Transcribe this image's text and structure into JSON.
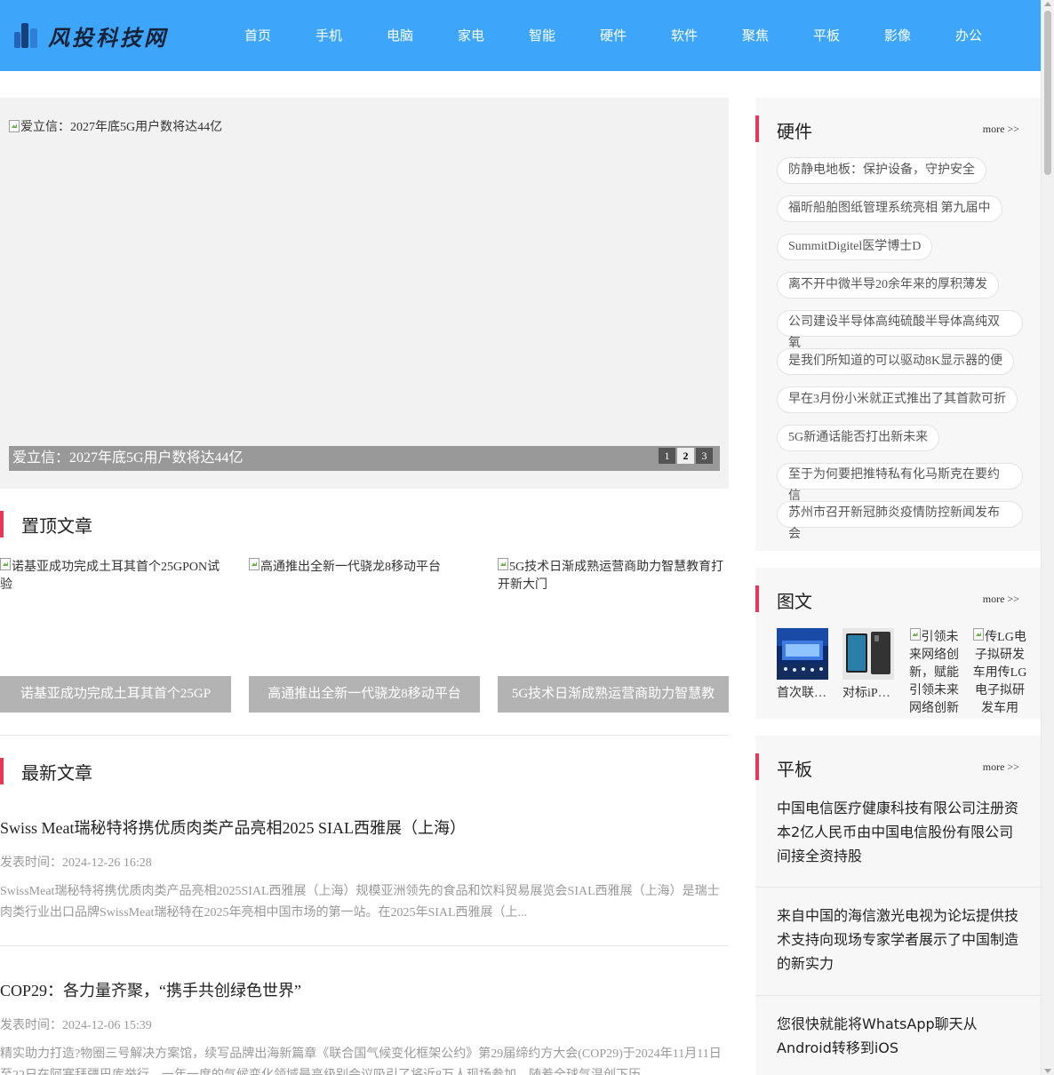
{
  "header": {
    "logo_text": "风投科技网",
    "nav": [
      "首页",
      "手机",
      "电脑",
      "家电",
      "智能",
      "硬件",
      "软件",
      "聚焦",
      "平板",
      "影像",
      "办公"
    ]
  },
  "slider": {
    "image_alt": "爱立信：2027年底5G用户数将达44亿",
    "caption": "爱立信：2027年底5G用户数将达44亿",
    "pages": [
      "1",
      "2",
      "3"
    ],
    "active_page": "2"
  },
  "top_section": {
    "title": "置顶文章",
    "cards": [
      {
        "alt": "诺基亚成功完成土耳其首个25GPON试验",
        "caption": "诺基亚成功完成土耳其首个25GP"
      },
      {
        "alt": "高通推出全新一代骁龙8移动平台",
        "caption": "高通推出全新一代骁龙8移动平台"
      },
      {
        "alt": "5G技术日渐成熟运营商助力智慧教育打开新大门",
        "caption": "5G技术日渐成熟运营商助力智慧教"
      }
    ]
  },
  "latest_section": {
    "title": "最新文章",
    "time_label": "发表时间：",
    "articles": [
      {
        "title": "Swiss Meat瑞秘特将携优质肉类产品亮相2025 SIAL西雅展（上海）",
        "time": "2024-12-26 16:28",
        "summary": "SwissMeat瑞秘特将携优质肉类产品亮相2025SIAL西雅展（上海）规模亚洲领先的食品和饮料贸易展览会SIAL西雅展（上海）是瑞士肉类行业出口品牌SwissMeat瑞秘特在2025年亮相中国市场的第一站。在2025年SIAL西雅展（上..."
      },
      {
        "title": "COP29：各力量齐聚，“携手共创绿色世界”",
        "time": "2024-12-06 15:39",
        "summary": "精实助力打造?物圈三号解决方案馆，续写品牌出海新篇章《联合国气候变化框架公约》第29届缔约方大会(COP29)于2024年11月11日至22日在阿塞拜疆巴库举行。一年一度的气候变化领域最高级别会议吸引了将近8万人现场参加。随着全球气温创下历"
      }
    ]
  },
  "sidebar": {
    "hardware": {
      "title": "硬件",
      "more": "more >>",
      "tags": [
        "防静电地板：保护设备，守护安全",
        "福昕船舶图纸管理系统亮相 第九届中",
        "SummitDigitel医学博士D",
        "离不开中微半导20余年来的厚积薄发",
        "公司建设半导体高纯硫酸半导体高纯双氧",
        "是我们所知道的可以驱动8K显示器的便",
        "早在3月份小米就正式推出了其首款可折",
        "5G新通话能否打出新未来",
        "至于为何要把推特私有化马斯克在要约信",
        "苏州市召开新冠肺炎疫情防控新闻发布会"
      ]
    },
    "pictures": {
      "title": "图文",
      "more": "more >>",
      "items": [
        {
          "caption": "首次联合举办",
          "alt": ""
        },
        {
          "caption": "对标iPad Pro",
          "alt": ""
        },
        {
          "caption": "",
          "alt": "引领未来网络创新，赋能引领未来网络创新"
        },
        {
          "caption": "",
          "alt": "传LG电子拟研发车用传LG电子拟研发车用"
        }
      ]
    },
    "tablet": {
      "title": "平板",
      "more": "more >>",
      "items": [
        "中国电信医疗健康科技有限公司注册资本2亿人民币由中国电信股份有限公司间接全资持股",
        "来自中国的海信激光电视为论坛提供技术支持向现场专家学者展示了中国制造的新实力",
        "您很快就能将WhatsApp聊天从Android转移到iOS"
      ]
    }
  },
  "colors": {
    "header_bg": "#3ea6fa",
    "accent": "#e8375a"
  }
}
